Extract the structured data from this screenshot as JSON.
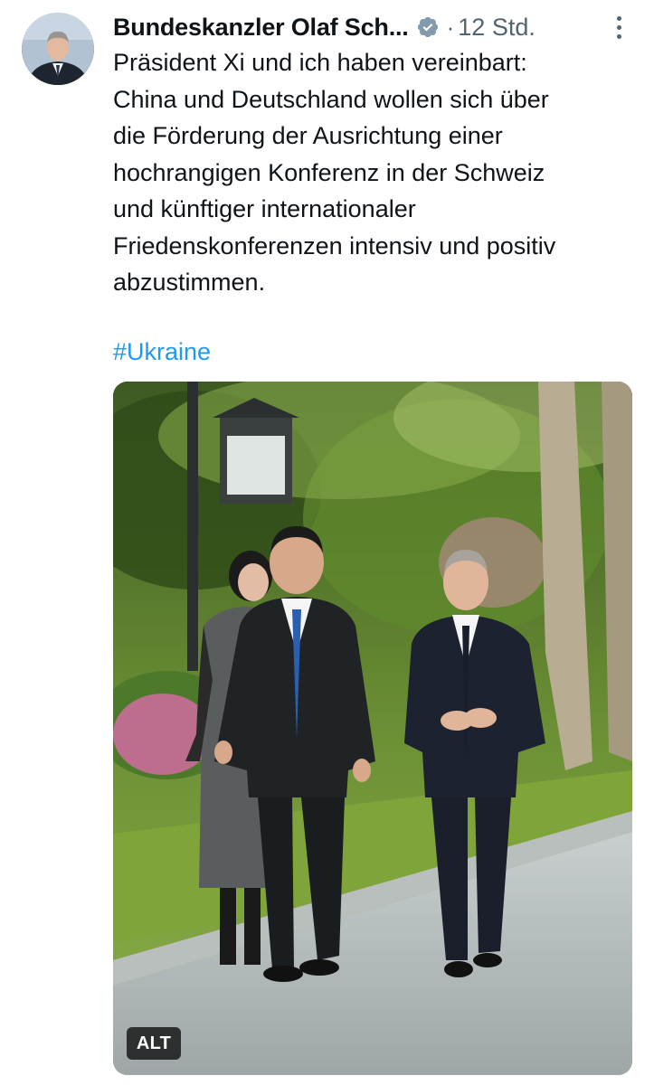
{
  "tweet": {
    "author": {
      "display_name": "Bundeskanzler Olaf Sch...",
      "verified_icon": "verified-badge-icon",
      "verified_color": "#829aab"
    },
    "separator": "·",
    "timestamp": "12 Std.",
    "text_lines": [
      "Präsident Xi und ich haben vereinbart:",
      "China und Deutschland wollen sich über",
      "die Förderung der Ausrichtung einer",
      "hochrangigen Konferenz in der Schweiz",
      "und künftiger internationaler",
      "Friedenskonferenzen intensiv und positiv",
      "abzustimmen."
    ],
    "hashtag": "#Ukraine",
    "hashtag_color": "#1d9bf0",
    "media": {
      "alt_badge": "ALT"
    },
    "more_icon": "more-vertical-icon"
  }
}
